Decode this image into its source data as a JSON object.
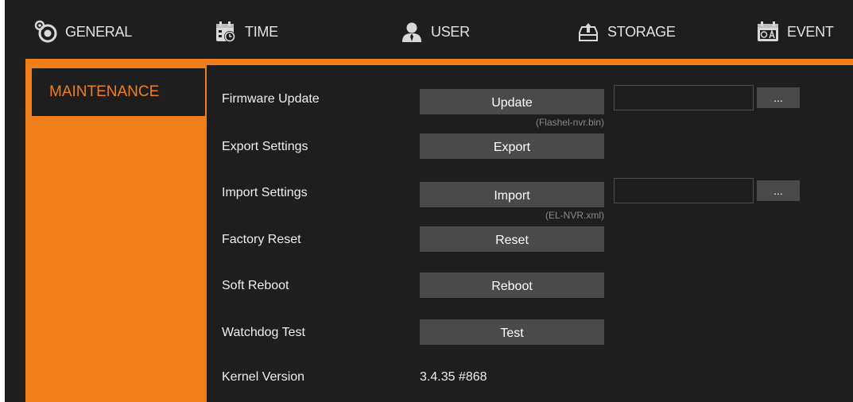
{
  "tabs": [
    {
      "label": "GENERAL",
      "icon": "gear-icon"
    },
    {
      "label": "TIME",
      "icon": "calendar-clock-icon"
    },
    {
      "label": "USER",
      "icon": "user-icon"
    },
    {
      "label": "STORAGE",
      "icon": "storage-upload-icon"
    },
    {
      "label": "EVENT",
      "icon": "calendar-event-icon"
    }
  ],
  "sidebar": {
    "items": [
      {
        "label": "MAINTENANCE"
      }
    ]
  },
  "maintenance": {
    "firmware": {
      "label": "Firmware Update",
      "button": "Update",
      "hint": "(Flashel-nvr.bin)",
      "file_value": "",
      "browse": "..."
    },
    "export": {
      "label": "Export Settings",
      "button": "Export"
    },
    "import": {
      "label": "Import Settings",
      "button": "Import",
      "hint": "(EL-NVR.xml)",
      "file_value": "",
      "browse": "..."
    },
    "factory_reset": {
      "label": "Factory Reset",
      "button": "Reset"
    },
    "soft_reboot": {
      "label": "Soft Reboot",
      "button": "Reboot"
    },
    "watchdog": {
      "label": "Watchdog Test",
      "button": "Test"
    },
    "kernel": {
      "label": "Kernel Version",
      "value": "3.4.35 #868"
    }
  },
  "colors": {
    "accent": "#f07e1a",
    "background": "#1e1e1e",
    "button": "#4a4a4a",
    "text": "#eeeeee",
    "hint": "#8a8a8a"
  }
}
